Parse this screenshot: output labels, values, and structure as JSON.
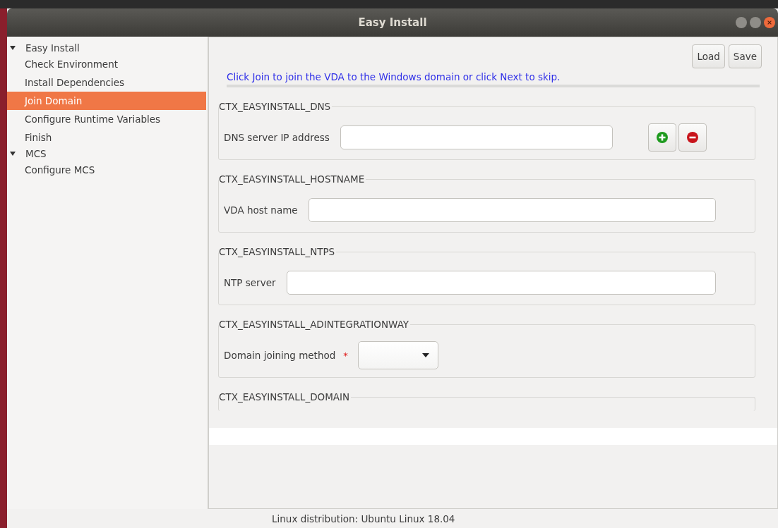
{
  "window": {
    "title": "Easy Install"
  },
  "sidebar": {
    "items": [
      {
        "label": "Easy Install",
        "expanded": true,
        "selected": false,
        "children": [
          {
            "label": "Check Environment",
            "selected": false
          },
          {
            "label": "Install Dependencies",
            "selected": false
          },
          {
            "label": "Join Domain",
            "selected": true
          },
          {
            "label": "Configure Runtime Variables",
            "selected": false
          },
          {
            "label": "Finish",
            "selected": false
          }
        ]
      },
      {
        "label": "MCS",
        "expanded": true,
        "selected": false,
        "children": [
          {
            "label": "Configure MCS",
            "selected": false
          }
        ]
      }
    ]
  },
  "toolbar": {
    "buttons": [
      "Load",
      "Save"
    ]
  },
  "instruction": "Click Join to join the VDA to the Windows domain or click Next to skip.",
  "groups": [
    {
      "title": "CTX_EASYINSTALL_DNS",
      "label": "DNS server IP address",
      "kind": "text",
      "list_buttons": true
    },
    {
      "title": "CTX_EASYINSTALL_HOSTNAME",
      "label": "VDA host name",
      "kind": "text",
      "list_buttons": false
    },
    {
      "title": "CTX_EASYINSTALL_NTPS",
      "label": "NTP server",
      "kind": "text",
      "list_buttons": false
    },
    {
      "title": "CTX_EASYINSTALL_ADINTEGRATIONWAY",
      "label": "Domain joining method",
      "required_mark": "*",
      "kind": "select",
      "list_buttons": false
    },
    {
      "title": "CTX_EASYINSTALL_DOMAIN",
      "kind": "cut"
    }
  ],
  "status_bar": "Linux distribution: Ubuntu Linux 18.04"
}
